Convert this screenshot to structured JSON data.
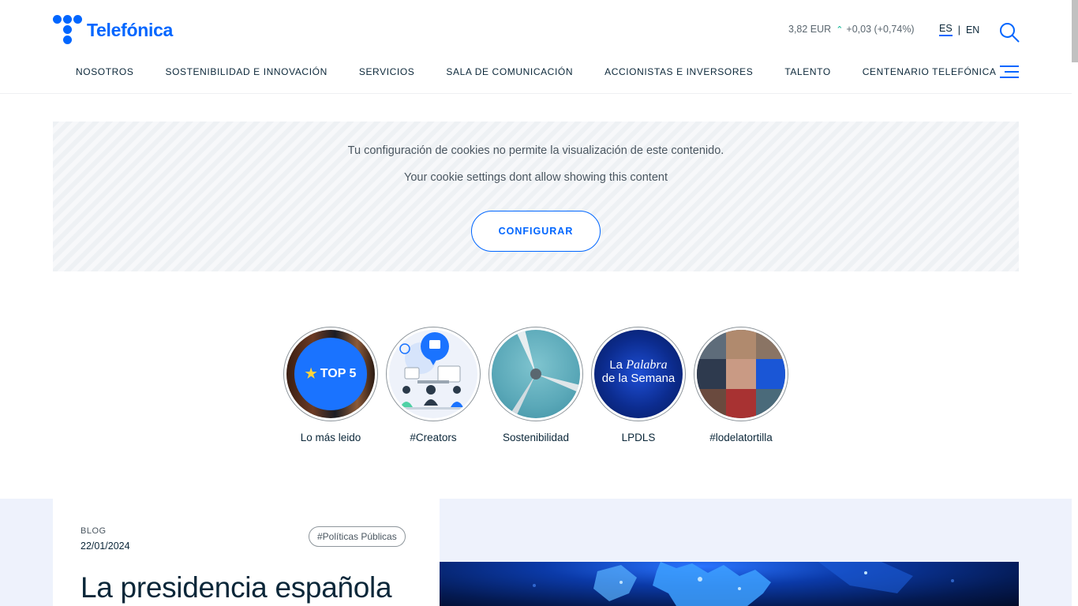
{
  "brand": {
    "name": "Telefónica",
    "accent": "#0066ff"
  },
  "stock": {
    "price": "3,82 EUR",
    "change": "+0,03 (+0,74%)"
  },
  "lang": {
    "es": "ES",
    "separator": "|",
    "en": "EN"
  },
  "nav": {
    "items": [
      {
        "label": "NOSOTROS"
      },
      {
        "label": "SOSTENIBILIDAD E INNOVACIÓN"
      },
      {
        "label": "SERVICIOS"
      },
      {
        "label": "SALA DE COMUNICACIÓN"
      },
      {
        "label": "ACCIONISTAS E INVERSORES"
      },
      {
        "label": "TALENTO"
      },
      {
        "label": "CENTENARIO TELEFÓNICA"
      }
    ]
  },
  "cookie": {
    "message_es": "Tu configuración de cookies no permite la visualización de este contenido.",
    "message_en": "Your cookie settings dont allow showing this content",
    "button": "CONFIGURAR"
  },
  "stories": [
    {
      "label": "Lo más leido",
      "badge": "TOP 5"
    },
    {
      "label": "#Creators"
    },
    {
      "label": "Sostenibilidad"
    },
    {
      "label": "LPDLS",
      "line1": "La ",
      "line1_italic": "Palabra",
      "line2": "de la Semana"
    },
    {
      "label": "#lodelatortilla"
    }
  ],
  "feature": {
    "kicker": "BLOG",
    "date": "22/01/2024",
    "tag": "#Políticas Públicas",
    "headline": "La presidencia española"
  }
}
